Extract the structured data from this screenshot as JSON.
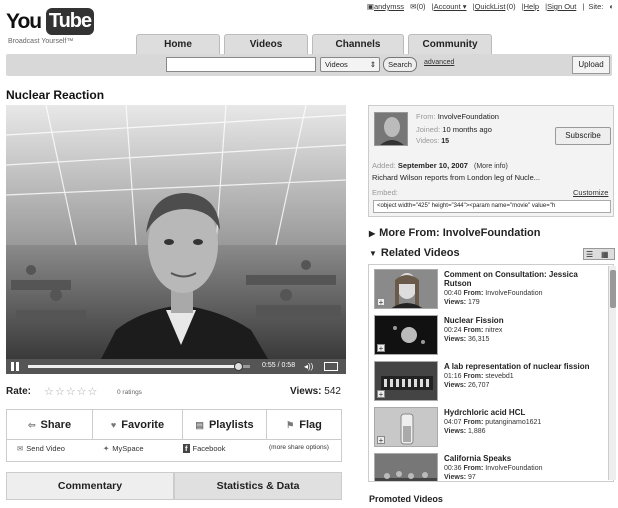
{
  "header": {
    "logo_you": "You",
    "logo_tube": "Tube",
    "logo_tagline": "Broadcast Yourself™",
    "user": "andymss",
    "inbox": "(0)",
    "account": "Account ▾",
    "quicklist": "QuickList",
    "quicklist_count": "(0)",
    "help": "Help",
    "signout": "Sign Out",
    "site": "Site:"
  },
  "nav": {
    "tabs": [
      "Home",
      "Videos",
      "Channels",
      "Community"
    ]
  },
  "search": {
    "placeholder": "",
    "select": "Videos",
    "button": "Search",
    "advanced": "advanced",
    "upload": "Upload"
  },
  "video": {
    "title": "Nuclear Reaction",
    "time": "0:55 / 0:58",
    "progress": 0.95,
    "rate_label": "Rate:",
    "ratings": "0 ratings",
    "views_label": "Views:",
    "views": "542"
  },
  "actions": {
    "share": "Share",
    "favorite": "Favorite",
    "playlists": "Playlists",
    "flag": "Flag",
    "send_video": "Send Video",
    "myspace": "MySpace",
    "facebook": "Facebook",
    "more_share": "(more share options)"
  },
  "comment_tabs": [
    "Commentary",
    "Statistics & Data"
  ],
  "info": {
    "from_label": "From:",
    "from": "InvolveFoundation",
    "joined_label": "Joined:",
    "joined": "10 months ago",
    "videos_label": "Videos:",
    "videos": "15",
    "subscribe": "Subscribe",
    "added_label": "Added:",
    "added": "September 10, 2007",
    "more_info": "(More info)",
    "description": "Richard Wilson reports from London leg of Nucle...",
    "embed_label": "Embed:",
    "customize": "Customize",
    "embed_code": "<object width=\"425\" height=\"344\"><param name=\"movie\" value=\"h"
  },
  "more_from": "More From: InvolveFoundation",
  "related_title": "Related Videos",
  "related": [
    {
      "title": "Comment on Consultation: Jessica Rutson",
      "time": "00:40",
      "from": "InvolveFoundation",
      "views": "179"
    },
    {
      "title": "Nuclear Fission",
      "time": "00:24",
      "from": "nitrex",
      "views": "36,315"
    },
    {
      "title": "A lab representation of nuclear fission",
      "time": "01:16",
      "from": "stevebd1",
      "views": "26,707"
    },
    {
      "title": "Hydrchloric acid HCL",
      "time": "04:07",
      "from": "putanginamo1621",
      "views": "1,886"
    },
    {
      "title": "California Speaks",
      "time": "00:36",
      "from": "InvolveFoundation",
      "views": "97"
    }
  ],
  "labels": {
    "from": "From:",
    "views": "Views:"
  },
  "promoted": "Promoted Videos"
}
